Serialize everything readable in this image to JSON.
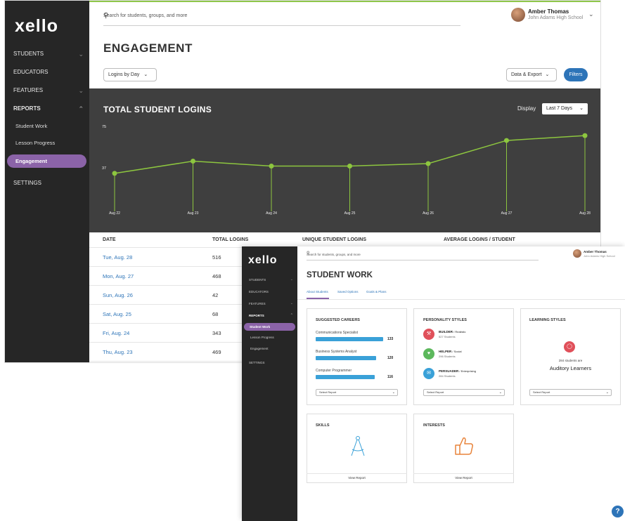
{
  "main": {
    "logo": "xello",
    "sidebar": {
      "students": "STUDENTS",
      "educators": "EDUCATORS",
      "features": "FEATURES",
      "reports": "REPORTS",
      "student_work": "Student Work",
      "lesson_progress": "Lesson Progress",
      "engagement": "Engagement",
      "settings": "SETTINGS"
    },
    "search_placeholder": "Search for students, groups, and more",
    "user_name": "Amber Thomas",
    "user_school": "John Adams High School",
    "page_title": "ENGAGEMENT",
    "view_dropdown": "Logins by Day",
    "data_export": "Data & Export",
    "filters": "Filters",
    "chart_title": "TOTAL STUDENT LOGINS",
    "display_label": "Display",
    "display_value": "Last 7 Days",
    "table_headers": {
      "date": "DATE",
      "total": "TOTAL LOGINS",
      "unique": "UNIQUE STUDENT LOGINS",
      "average": "AVERAGE LOGINS / STUDENT"
    },
    "rows": [
      {
        "date": "Tue, Aug. 28",
        "total": "516"
      },
      {
        "date": "Mon, Aug. 27",
        "total": "468"
      },
      {
        "date": "Sun, Aug. 26",
        "total": "42"
      },
      {
        "date": "Sat, Aug. 25",
        "total": "68"
      },
      {
        "date": "Fri, Aug. 24",
        "total": "343"
      },
      {
        "date": "Thu, Aug. 23",
        "total": "469"
      }
    ]
  },
  "chart_data": {
    "type": "line",
    "title": "TOTAL STUDENT LOGINS",
    "x": [
      "Aug 22",
      "Aug 23",
      "Aug 24",
      "Aug 25",
      "Aug 26",
      "Aug 27",
      "Aug 28"
    ],
    "y_ticks": [
      "75",
      "37"
    ],
    "values": [
      37,
      47,
      43,
      43,
      45,
      64,
      68
    ],
    "ylim": [
      0,
      75
    ],
    "line_color": "#8dc63f",
    "background": "#3f3f3f"
  },
  "second": {
    "logo": "xello",
    "sidebar": {
      "students": "STUDENTS",
      "educators": "EDUCATORS",
      "features": "FEATURES",
      "reports": "REPORTS",
      "student_work": "Student Work",
      "lesson_progress": "Lesson Progress",
      "engagement": "Engagement",
      "settings": "SETTINGS"
    },
    "search_placeholder": "Search for students, groups, and more",
    "user_name": "Amber Thomas",
    "user_school": "John Adams High School",
    "page_title": "STUDENT WORK",
    "tabs": [
      "About Students",
      "Saved Options",
      "Goals & Plans"
    ],
    "careers": {
      "title": "SUGGESTED CAREERS",
      "items": [
        {
          "name": "Communications Specialist",
          "count": "133",
          "fraction": 1.0
        },
        {
          "name": "Business Systems Analyst",
          "count": "120",
          "fraction": 0.9
        },
        {
          "name": "Computer Programmer",
          "count": "116",
          "fraction": 0.87
        }
      ],
      "select": "Select Report"
    },
    "personality": {
      "title": "PERSONALITY STYLES",
      "items": [
        {
          "name": "BUILDER",
          "sub": " / Realistic",
          "count": "527 Students",
          "color": "#e0505a"
        },
        {
          "name": "HELPER",
          "sub": " / Social",
          "count": "296 Students",
          "color": "#5cb85c"
        },
        {
          "name": "PERSUADER",
          "sub": " / Enterprising",
          "count": "284 Students",
          "color": "#3aa1d8"
        }
      ],
      "select": "Select Report"
    },
    "learning": {
      "title": "LEARNING STYLES",
      "line1": "284 students are",
      "line2": "Auditory Learners",
      "select": "Select Report"
    },
    "skills": {
      "title": "SKILLS",
      "link": "View Report"
    },
    "interests": {
      "title": "INTERESTS",
      "link": "View Report"
    }
  },
  "help": "?"
}
